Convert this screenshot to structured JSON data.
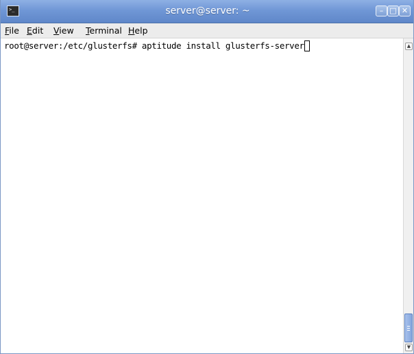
{
  "window": {
    "title": "server@server: ~"
  },
  "menu": {
    "file": {
      "mnemonic": "F",
      "rest": "ile"
    },
    "edit": {
      "mnemonic": "E",
      "rest": "dit"
    },
    "view": {
      "mnemonic": "V",
      "rest": "iew"
    },
    "terminal": {
      "mnemonic": "T",
      "rest": "erminal"
    },
    "help": {
      "mnemonic": "H",
      "rest": "elp"
    }
  },
  "terminal": {
    "line": "root@server:/etc/glusterfs# aptitude install glusterfs-server"
  },
  "scrollbar": {
    "position": 1.0
  },
  "icons": {
    "app": "terminal-icon",
    "minimize": "minimize-icon",
    "maximize": "maximize-icon",
    "close": "close-icon",
    "scroll_up": "chevron-up-icon",
    "scroll_down": "chevron-down-icon"
  },
  "colors": {
    "titlebar": "#6f95d4",
    "title_text": "#ffffff",
    "menubar": "#ececec",
    "terminal_bg": "#ffffff",
    "terminal_fg": "#000000",
    "scroll_thumb": "#8fb0e2"
  }
}
